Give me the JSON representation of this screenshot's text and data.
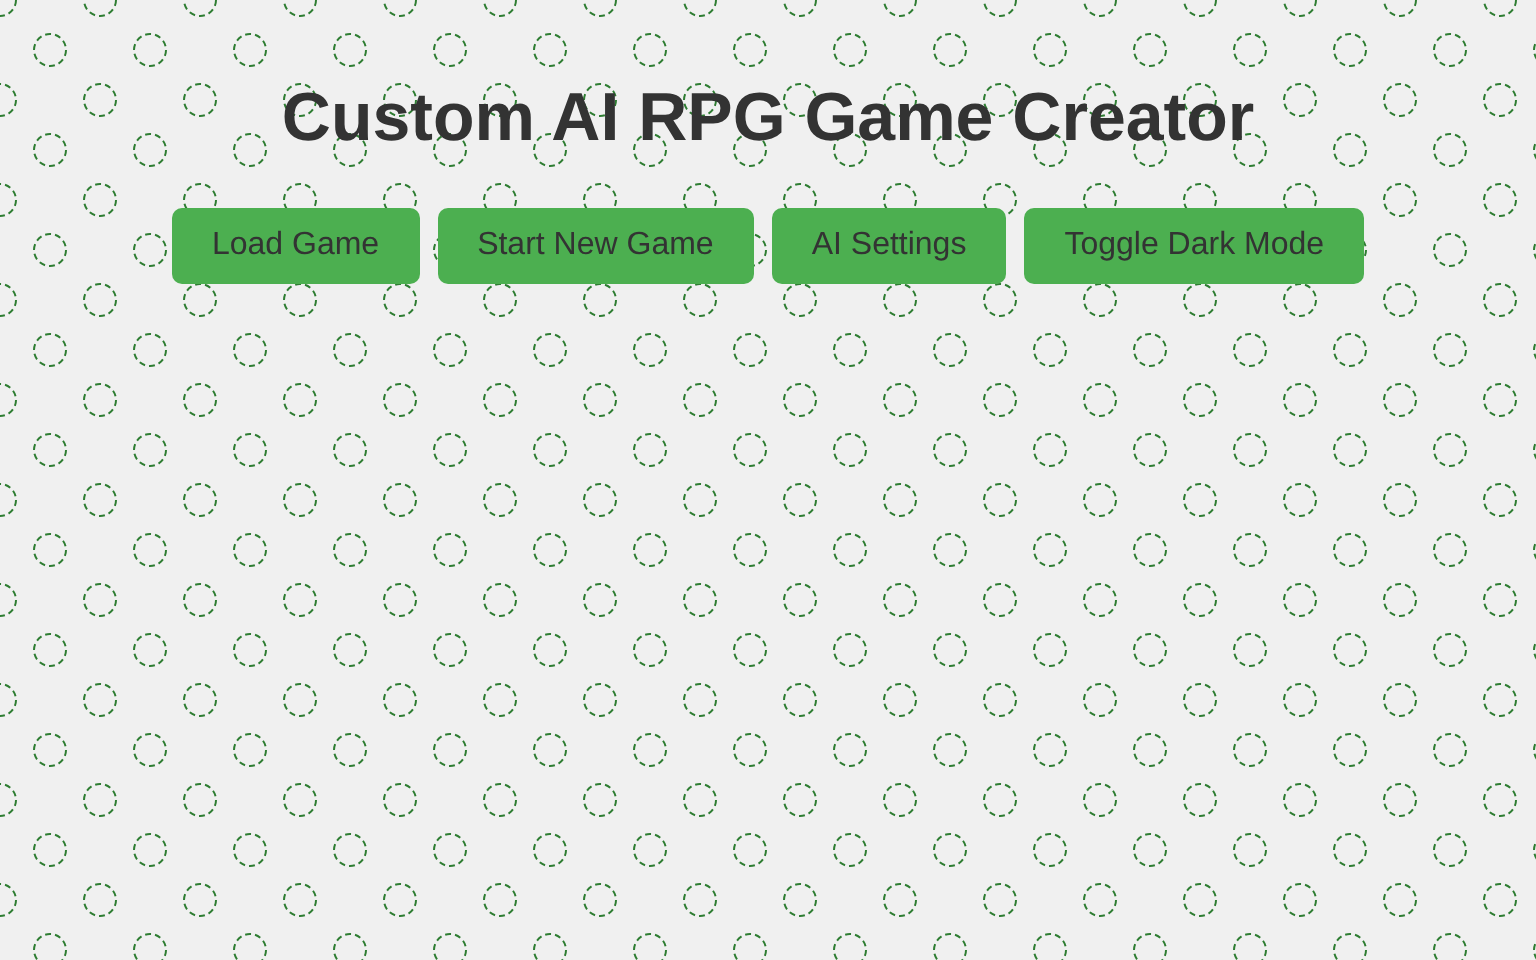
{
  "title": "Custom AI RPG Game Creator",
  "buttons": [
    {
      "label": "Load Game"
    },
    {
      "label": "Start New Game"
    },
    {
      "label": "AI Settings"
    },
    {
      "label": "Toggle Dark Mode"
    }
  ]
}
